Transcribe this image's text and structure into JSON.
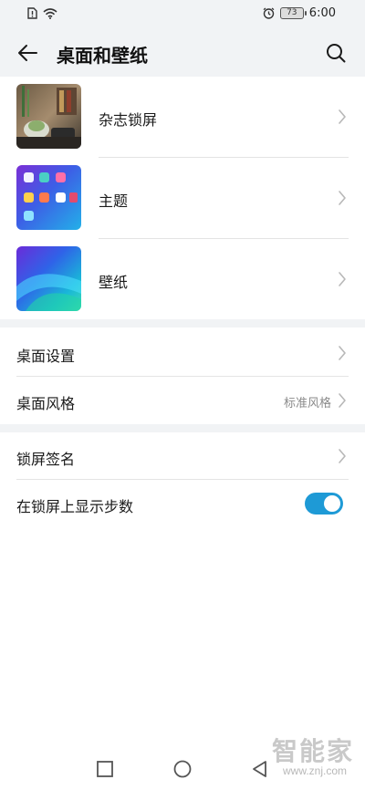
{
  "status_bar": {
    "battery_level": "73",
    "time": "6:00"
  },
  "header": {
    "title": "桌面和壁纸"
  },
  "themes_card": {
    "items": [
      {
        "label": "杂志锁屏"
      },
      {
        "label": "主题"
      },
      {
        "label": "壁纸"
      }
    ]
  },
  "desktop_card": {
    "settings_label": "桌面设置",
    "style_label": "桌面风格",
    "style_value": "标准风格"
  },
  "lockscreen_card": {
    "signature_label": "锁屏签名",
    "steps_label": "在锁屏上显示步数",
    "steps_enabled": true
  },
  "watermark": {
    "text": "智能家",
    "url": "www.znj.com"
  },
  "colors": {
    "accent": "#1e9ad6",
    "background": "#f1f3f5",
    "card": "#ffffff"
  }
}
